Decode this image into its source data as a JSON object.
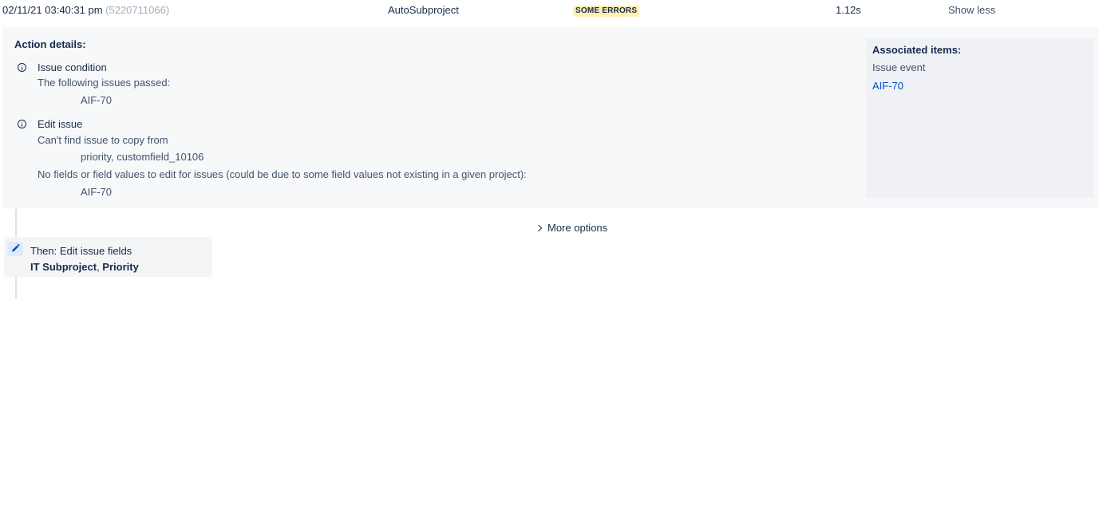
{
  "summary": {
    "timestamp": "02/11/21 03:40:31 pm",
    "audit_id": "(5220711066)",
    "rule_name": "AutoSubproject",
    "status_badge": "SOME ERRORS",
    "duration": "1.12s",
    "toggle_label": "Show less"
  },
  "details": {
    "title": "Action details:",
    "items": [
      {
        "icon": "info-icon",
        "heading": "Issue condition",
        "lines": [
          {
            "text": "The following issues passed:"
          },
          {
            "text": "AIF-70",
            "indented": true
          }
        ]
      },
      {
        "icon": "info-icon",
        "heading": "Edit issue",
        "lines": [
          {
            "text": "Can't find issue to copy from"
          },
          {
            "text": "priority, customfield_10106",
            "indented": true
          },
          {
            "text": "No fields or field values to edit for issues (could be due to some field values not existing in a given project):"
          },
          {
            "text": "AIF-70",
            "indented": true
          }
        ]
      }
    ]
  },
  "associated": {
    "title": "Associated items:",
    "event_label": "Issue event",
    "issue_link": "AIF-70"
  },
  "more_options_label": "More options",
  "action_card": {
    "icon": "pencil-icon",
    "title": "Then: Edit issue fields",
    "field1": "IT Subproject",
    "separator": ", ",
    "field2": "Priority"
  },
  "colors": {
    "badge_bg": "#fff0b3",
    "link": "#0052cc",
    "panel_bg": "#f7f8f9",
    "assoc_bg": "#eff1f4"
  }
}
